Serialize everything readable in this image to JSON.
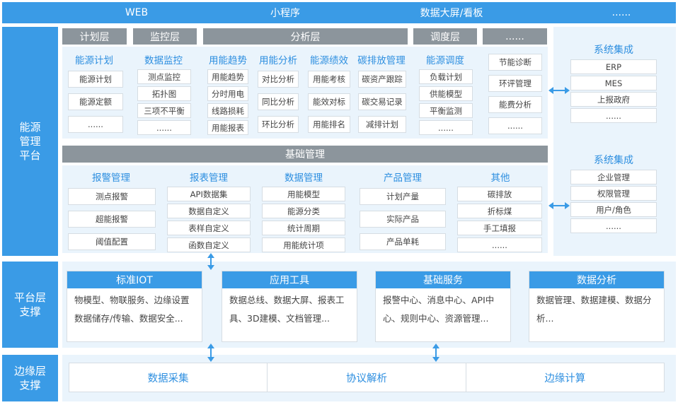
{
  "top_bar": [
    "WEB",
    "小程序",
    "数据大屏/看板",
    "......"
  ],
  "left_labels": {
    "energy": [
      "能源",
      "管理",
      "平台"
    ],
    "platform": [
      "平台层",
      "支撑"
    ],
    "edge": [
      "边缘层",
      "支撑"
    ]
  },
  "layers": [
    "计划层",
    "监控层",
    "分析层",
    "调度层",
    "......"
  ],
  "energy_columns": [
    {
      "title": "能源计划",
      "items": [
        "能源计划",
        "能源定额",
        "......"
      ]
    },
    {
      "title": "数据监控",
      "items": [
        "测点监控",
        "拓扑图",
        "三项不平衡",
        "......"
      ]
    },
    {
      "title": "用能趋势",
      "items": [
        "用能趋势",
        "分时用电",
        "线路损耗",
        "用能报表"
      ]
    },
    {
      "title": "用能分析",
      "items": [
        "对比分析",
        "同比分析",
        "环比分析"
      ]
    },
    {
      "title": "能源绩效",
      "items": [
        "用能考核",
        "能效对标",
        "用能排名"
      ]
    },
    {
      "title": "碳排放管理",
      "items": [
        "碳资产跟踪",
        "碳交易记录",
        "减排计划"
      ]
    },
    {
      "title": "能源调度",
      "items": [
        "负载计划",
        "供能模型",
        "平衡监测",
        "......"
      ]
    },
    {
      "title": "",
      "items": [
        "节能诊断",
        "环评管理",
        "能费分析",
        "......"
      ]
    }
  ],
  "basic_mgmt": {
    "title": "基础管理",
    "columns": [
      {
        "title": "报警管理",
        "items": [
          "测点报警",
          "超能报警",
          "阈值配置"
        ]
      },
      {
        "title": "报表管理",
        "items": [
          "API数据集",
          "数据自定义",
          "表样自定义",
          "函数自定义"
        ]
      },
      {
        "title": "数据管理",
        "items": [
          "用能模型",
          "能源分类",
          "统计周期",
          "用能统计项"
        ]
      },
      {
        "title": "产品管理",
        "items": [
          "计划产量",
          "实际产品",
          "产品单耗"
        ]
      },
      {
        "title": "其他",
        "items": [
          "碳排放",
          "折标煤",
          "手工填报",
          "......"
        ]
      }
    ]
  },
  "system_integration": [
    {
      "title": "系统集成",
      "items": [
        "ERP",
        "MES",
        "上报政府",
        "......"
      ]
    },
    {
      "title": "系统集成",
      "items": [
        "企业管理",
        "权限管理",
        "用户/角色",
        "......"
      ]
    }
  ],
  "platform_support": [
    {
      "title": "标准IOT",
      "desc": "物模型、物联服务、边缘设置数据储存/传输、数据安全..."
    },
    {
      "title": "应用工具",
      "desc": "数据总线、数据大屏、报表工具、3D建模、文档管理..."
    },
    {
      "title": "基础服务",
      "desc": "报警中心、消息中心、API中心、规则中心、资源管理..."
    },
    {
      "title": "数据分析",
      "desc": "数据管理、数据建模、数据分析..."
    }
  ],
  "edge_support": [
    "数据采集",
    "协议解析",
    "边缘计算"
  ],
  "colors": {
    "accent": "#3a9be6",
    "header_gray": "#8c959c",
    "panel": "#eaf4fc"
  }
}
